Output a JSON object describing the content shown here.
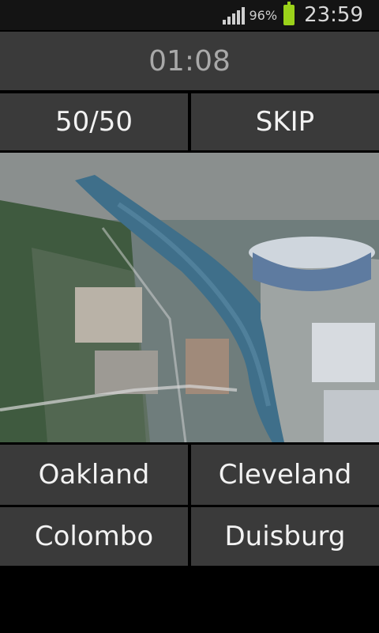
{
  "status_bar": {
    "battery_percent": "96%",
    "time": "23:59",
    "battery_color": "#9bd21a"
  },
  "game": {
    "timer": "01:08",
    "lifelines": {
      "fifty_fifty_label": "50/50",
      "skip_label": "SKIP"
    },
    "answers": {
      "a1": "Oakland",
      "a2": "Cleveland",
      "a3": "Colombo",
      "a4": "Duisburg"
    }
  }
}
